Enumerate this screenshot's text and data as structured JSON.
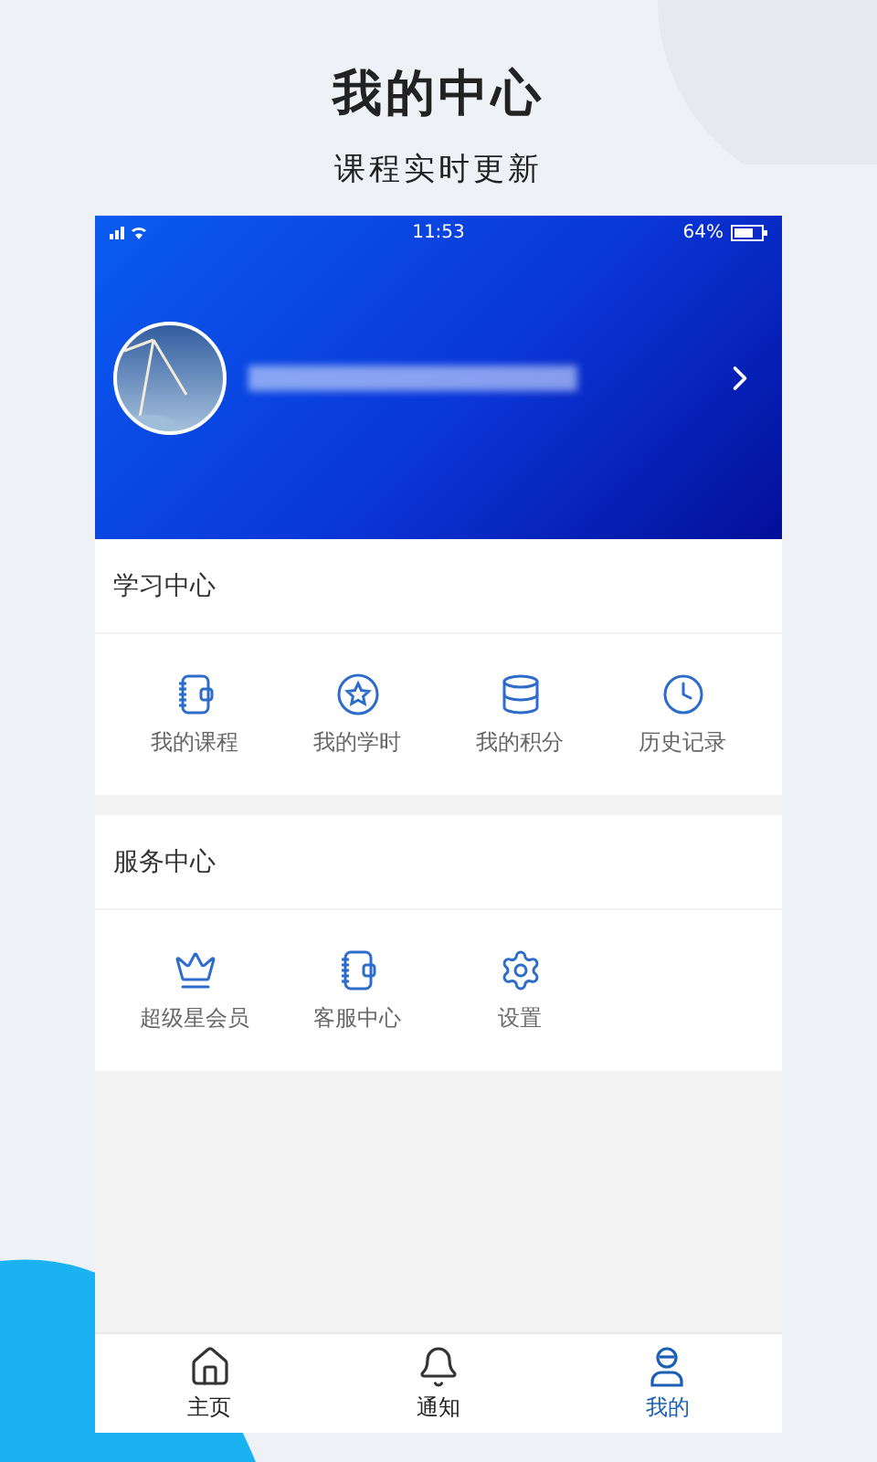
{
  "promo": {
    "title": "我的中心",
    "subtitle": "课程实时更新"
  },
  "status_bar": {
    "time": "11:53",
    "battery": "64%"
  },
  "sections": [
    {
      "title": "学习中心",
      "items": [
        {
          "label": "我的课程",
          "kind": "notebook"
        },
        {
          "label": "我的学时",
          "kind": "star"
        },
        {
          "label": "我的积分",
          "kind": "coins"
        },
        {
          "label": "历史记录",
          "kind": "clock"
        }
      ]
    },
    {
      "title": "服务中心",
      "items": [
        {
          "label": "超级星会员",
          "kind": "crown"
        },
        {
          "label": "客服中心",
          "kind": "notebook"
        },
        {
          "label": "设置",
          "kind": "gear"
        }
      ]
    }
  ],
  "tab_bar": [
    {
      "label": "主页",
      "kind": "home",
      "selected": false
    },
    {
      "label": "通知",
      "kind": "bell",
      "selected": false
    },
    {
      "label": "我的",
      "kind": "user",
      "selected": true
    }
  ]
}
